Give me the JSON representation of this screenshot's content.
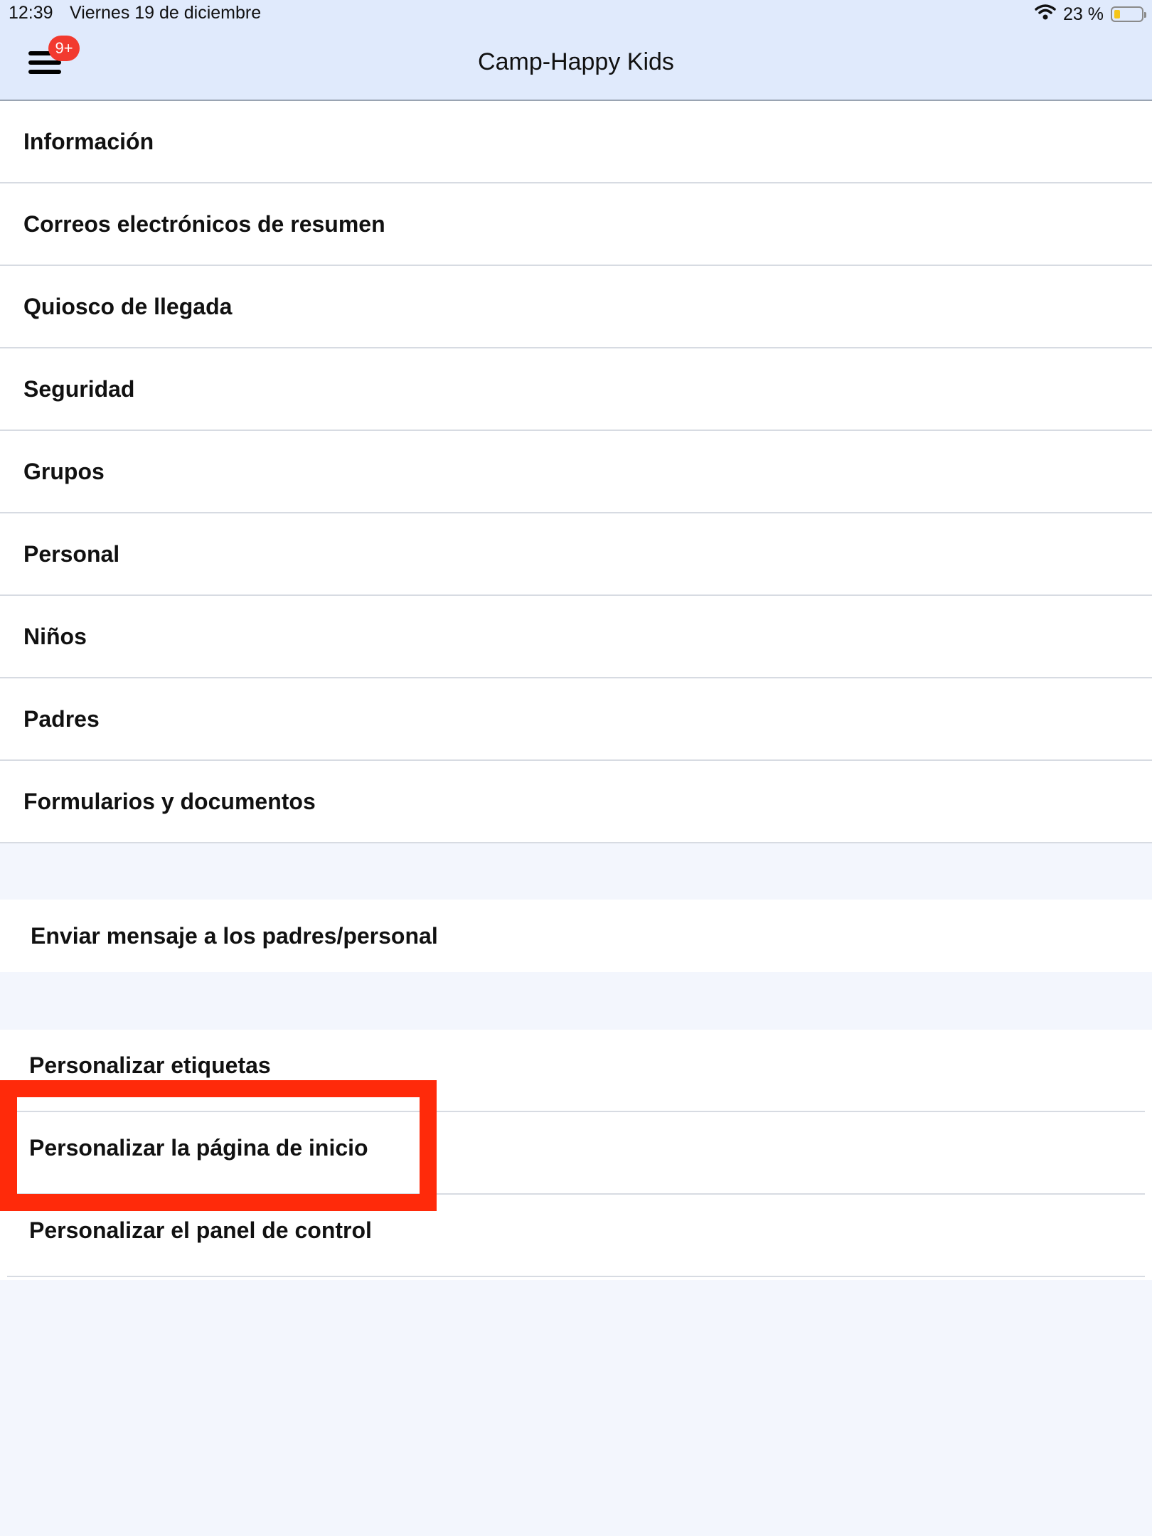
{
  "status_bar": {
    "time": "12:39",
    "date": "Viernes 19 de diciembre",
    "battery_percent_label": "23 %",
    "battery_level": 0.23,
    "icons": [
      "wifi-icon",
      "battery-icon"
    ]
  },
  "header": {
    "title": "Camp-Happy Kids",
    "menu_badge": "9+",
    "menu_icon": "hamburger-menu-icon"
  },
  "settings_list": [
    {
      "label": "Información"
    },
    {
      "label": "Correos electrónicos de resumen"
    },
    {
      "label": "Quiosco de llegada"
    },
    {
      "label": "Seguridad"
    },
    {
      "label": "Grupos"
    },
    {
      "label": "Personal"
    },
    {
      "label": "Niños"
    },
    {
      "label": "Padres"
    },
    {
      "label": "Formularios y documentos"
    }
  ],
  "send_message": {
    "label": "Enviar mensaje a los padres/personal"
  },
  "customize_list": [
    {
      "label": "Personalizar etiquetas"
    },
    {
      "label": "Personalizar la página de inicio",
      "highlighted": true
    },
    {
      "label": "Personalizar el panel de control"
    }
  ],
  "colors": {
    "header_bg": "#e0eafc",
    "page_bg": "#f3f6fd",
    "badge": "#f23a2f",
    "highlight": "#ff2a0a",
    "battery_fill": "#f5c518"
  }
}
